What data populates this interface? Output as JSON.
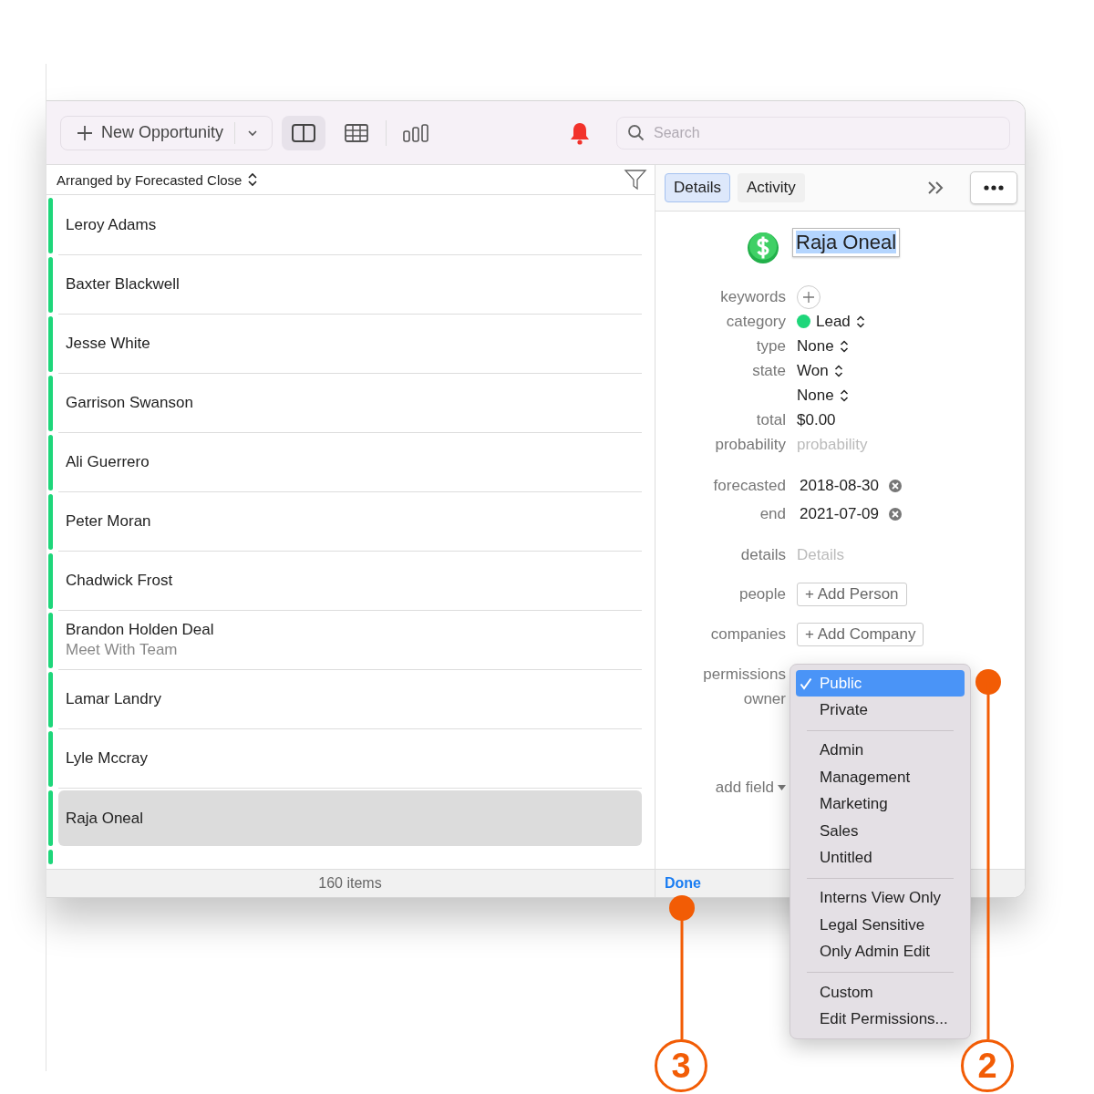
{
  "toolbar": {
    "new_button": "New Opportunity",
    "views": [
      {
        "kind": "split",
        "selected": true
      },
      {
        "kind": "table",
        "selected": false
      },
      {
        "kind": "chart",
        "selected": false
      }
    ],
    "search": {
      "placeholder": "Search"
    }
  },
  "list": {
    "sort_label": "Arranged by Forecasted Close",
    "items": [
      {
        "name": "Leroy Adams",
        "selected": false
      },
      {
        "name": "Baxter Blackwell",
        "selected": false
      },
      {
        "name": "Jesse White",
        "selected": false
      },
      {
        "name": "Garrison Swanson",
        "selected": false
      },
      {
        "name": "Ali Guerrero",
        "selected": false
      },
      {
        "name": "Peter Moran",
        "selected": false
      },
      {
        "name": "Chadwick Frost",
        "selected": false
      },
      {
        "name": "Brandon Holden Deal",
        "subtitle": "Meet With Team",
        "selected": false
      },
      {
        "name": "Lamar Landry",
        "selected": false
      },
      {
        "name": "Lyle Mccray",
        "selected": false
      },
      {
        "name": "Raja Oneal",
        "selected": true
      }
    ],
    "status": "160 items"
  },
  "detail": {
    "tabs": [
      {
        "label": "Details",
        "selected": true
      },
      {
        "label": "Activity",
        "selected": false
      }
    ],
    "title": "Raja Oneal",
    "field_groups": [
      [
        {
          "label": "keywords",
          "kind": "add"
        },
        {
          "label": "category",
          "kind": "popup",
          "value": "Lead",
          "color": "#1ed67a"
        },
        {
          "label": "type",
          "kind": "popup",
          "value": "None"
        },
        {
          "label": "state",
          "kind": "popup",
          "value": "Won"
        },
        {
          "kind": "popup",
          "value": "None"
        },
        {
          "label": "total",
          "kind": "text",
          "value": "$0.00"
        },
        {
          "label": "probability",
          "kind": "placeholder",
          "placeholder": "probability"
        }
      ],
      [
        {
          "label": "forecasted",
          "kind": "date",
          "value": "2018-08-30"
        },
        {
          "label": "end",
          "kind": "date",
          "value": "2021-07-09"
        }
      ],
      [
        {
          "label": "details",
          "kind": "placeholder",
          "placeholder": "Details"
        }
      ],
      [
        {
          "label": "people",
          "kind": "button",
          "value": "+ Add Person"
        }
      ],
      [
        {
          "label": "companies",
          "kind": "button",
          "value": "+ Add Company"
        }
      ],
      [
        {
          "label": "permissions",
          "kind": "empty"
        },
        {
          "label": "owner",
          "kind": "empty"
        }
      ]
    ],
    "add_field": "add field",
    "done": "Done"
  },
  "menu": {
    "sections": [
      [
        {
          "label": "Public",
          "selected": true
        },
        {
          "label": "Private",
          "selected": false
        }
      ],
      [
        {
          "label": "Admin",
          "selected": false
        },
        {
          "label": "Management",
          "selected": false
        },
        {
          "label": "Marketing",
          "selected": false
        },
        {
          "label": "Sales",
          "selected": false
        },
        {
          "label": "Untitled",
          "selected": false
        }
      ],
      [
        {
          "label": "Interns View Only",
          "selected": false
        },
        {
          "label": "Legal Sensitive",
          "selected": false
        },
        {
          "label": "Only Admin Edit",
          "selected": false
        }
      ],
      [
        {
          "label": "Custom",
          "selected": false
        },
        {
          "label": "Edit Permissions..."
        }
      ]
    ]
  },
  "callouts": [
    {
      "number": "3",
      "kind": "done"
    },
    {
      "number": "2",
      "kind": "menu"
    }
  ]
}
